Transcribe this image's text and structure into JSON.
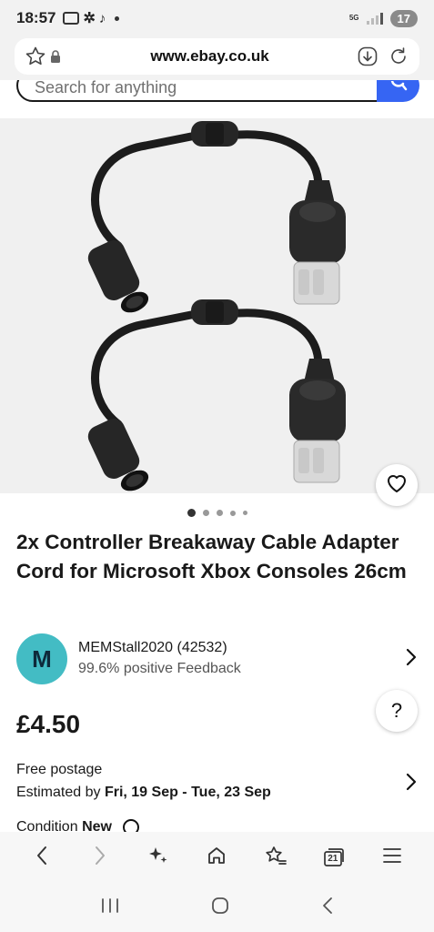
{
  "status_bar": {
    "time": "18:57",
    "network": "5G",
    "battery": "17"
  },
  "browser": {
    "url": "www.ebay.co.uk"
  },
  "search": {
    "placeholder": "Search for anything"
  },
  "gallery": {
    "image_count": 5,
    "active_index": 0
  },
  "listing": {
    "title": "2x Controller Breakaway Cable Adapter Cord for Microsoft Xbox Consoles 26cm",
    "price": "£4.50"
  },
  "seller": {
    "initial": "M",
    "name": "MEMStall2020 (42532)",
    "feedback": "99.6% positive Feedback"
  },
  "postage": {
    "line1": "Free postage",
    "estimated_prefix": "Estimated by ",
    "estimated_dates": "Fri, 19 Sep - Tue, 23 Sep"
  },
  "condition": {
    "label": "Condition",
    "value": "New"
  },
  "help": {
    "label": "?"
  },
  "bottom_nav": {
    "tabs_count": "21"
  },
  "colors": {
    "accent_blue": "#3665f3",
    "avatar_teal": "#43bcc4"
  }
}
